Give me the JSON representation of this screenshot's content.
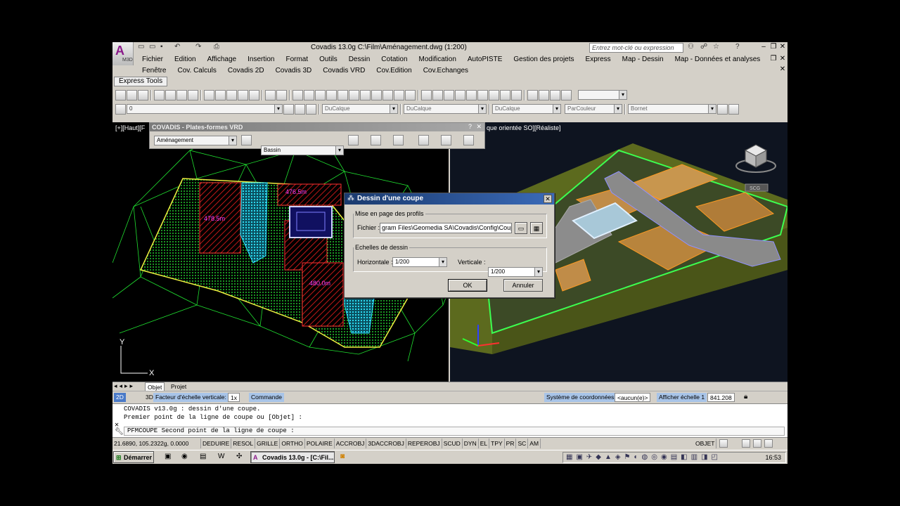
{
  "window": {
    "title": "Covadis 13.0g    C:\\Film\\Aménagement.dwg (1:200)",
    "search_placeholder": "Entrez mot-clé ou expression",
    "logo_letter": "A",
    "logo_sub": "M3D"
  },
  "menu_row1": [
    "Fichier",
    "Edition",
    "Affichage",
    "Insertion",
    "Format",
    "Outils",
    "Dessin",
    "Cotation",
    "Modification",
    "AutoPISTE",
    "Gestion des projets",
    "Express",
    "Map - Dessin",
    "Map - Données et analyses"
  ],
  "menu_row2": [
    "Fenêtre",
    "Cov. Calculs",
    "Covadis 2D",
    "Covadis 3D",
    "Covadis VRD",
    "Cov.Edition",
    "Cov.Echanges"
  ],
  "express_tab": "Express Tools",
  "layer_bar": {
    "layer_value": "0",
    "color": "DuCalque",
    "linetype": "DuCalque",
    "lineweight": "DuCalque",
    "plotstyle": "ParCouleur",
    "extra": "Bornet"
  },
  "viewports": {
    "left_label": "[+][Haut][F",
    "right_label": "que orientée SO][Réaliste]",
    "areas": [
      "478.5m",
      "476.5m",
      "480.0m"
    ],
    "viewcube_label": "SCG"
  },
  "palette": {
    "title": "COVADIS - Plates-formes VRD",
    "combo1": "Aménagement",
    "combo2": "Bassin"
  },
  "dialog": {
    "title": "Dessin d'une coupe",
    "group1": "Mise en page des profils",
    "file_label": "Fichier :",
    "file_value": "gram Files\\Geomedia SA\\Covadis\\Config\\Coupe.prf",
    "group2": "Echelles de dessin",
    "h_label": "Horizontale :",
    "h_value": "1/200",
    "v_label": "Verticale :",
    "v_value": "1/200",
    "ok": "OK",
    "cancel": "Annuler"
  },
  "model_tabs": [
    "Objet",
    "Projet"
  ],
  "status_top": {
    "mode2d": "2D",
    "mode3d": "3D",
    "scale_label": "Facteur d'échelle verticale:",
    "scale_value": "1x",
    "commande": "Commande",
    "coord_label": "Système de coordonnées:",
    "coord_value": "<aucun(e)>",
    "echelle_label": "Afficher échelle 1",
    "echelle_value": "841.208"
  },
  "command": {
    "line1": "COVADIS v13.0g : dessin d'une coupe.",
    "line2": "Premier point de la ligne de coupe ou [Objet] :",
    "prompt": "PFMCOUPE Second point de la ligne de coupe :"
  },
  "status_bar": {
    "coords": "21.6890, 105.2322g, 0.0000",
    "toggles": [
      "DEDUIRE",
      "RESOL",
      "GRILLE",
      "ORTHO",
      "POLAIRE",
      "ACCROBJ",
      "3DACCROBJ",
      "REPEROBJ",
      "SCUD",
      "DYN",
      "EL",
      "TPY",
      "PR",
      "SC",
      "AM"
    ],
    "objet": "OBJET"
  },
  "taskbar": {
    "start": "Démarrer",
    "task": "Covadis 13.0g - [C:\\Fil...",
    "clock": "16:53"
  },
  "colors": {
    "accent": "#3a6ab8",
    "hatch": "#ff2020",
    "cyan": "#20e0ff",
    "green": "#20ff40"
  }
}
